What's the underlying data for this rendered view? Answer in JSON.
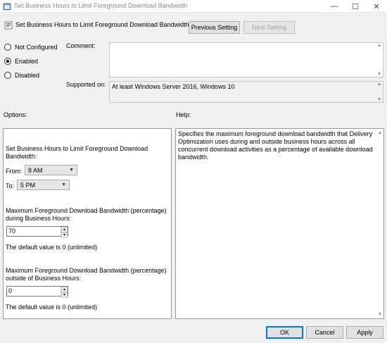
{
  "window": {
    "title": "Set Business Hours to Limit Foreground Download Bandwidth",
    "controls": [
      "minimize-icon",
      "maximize-icon",
      "close-icon"
    ]
  },
  "header": {
    "policy_title": "Set Business Hours to Limit Foreground Download Bandwidth",
    "previous_label": "Previous Setting",
    "next_label": "Next Setting"
  },
  "state": {
    "options": [
      {
        "label": "Not Configured",
        "checked": false
      },
      {
        "label": "Enabled",
        "checked": true
      },
      {
        "label": "Disabled",
        "checked": false
      }
    ]
  },
  "comment": {
    "label": "Comment:",
    "value": ""
  },
  "supported": {
    "label": "Supported on:",
    "value": "At least Windows Server 2016, Windows 10"
  },
  "sections": {
    "options_label": "Options:",
    "help_label": "Help:"
  },
  "options_panel": {
    "heading": "Set Business Hours to Limit Foreground Download Bandwidth:",
    "from_label": "From:",
    "from_value": "8 AM",
    "to_label": "To:",
    "to_value": "5 PM",
    "during_label": "Maximum Foreground Download Bandwidth (percentage) during Business Hours:",
    "during_value": "70",
    "during_default": "The default value is 0 (unlimited)",
    "outside_label": "Maximum Foreground Download Bandwidth (percentage) outside of Business Hours:",
    "outside_value": "0",
    "outside_default": "The default value is 0 (unlimited)"
  },
  "help": {
    "text": "Specifies the maximum foreground download bandwidth that Delivery Optimization uses during and outside business hours across all concurrent download activities as a percentage of available download bandwidth."
  },
  "footer": {
    "ok_label": "OK",
    "cancel_label": "Cancel",
    "apply_label": "Apply"
  }
}
